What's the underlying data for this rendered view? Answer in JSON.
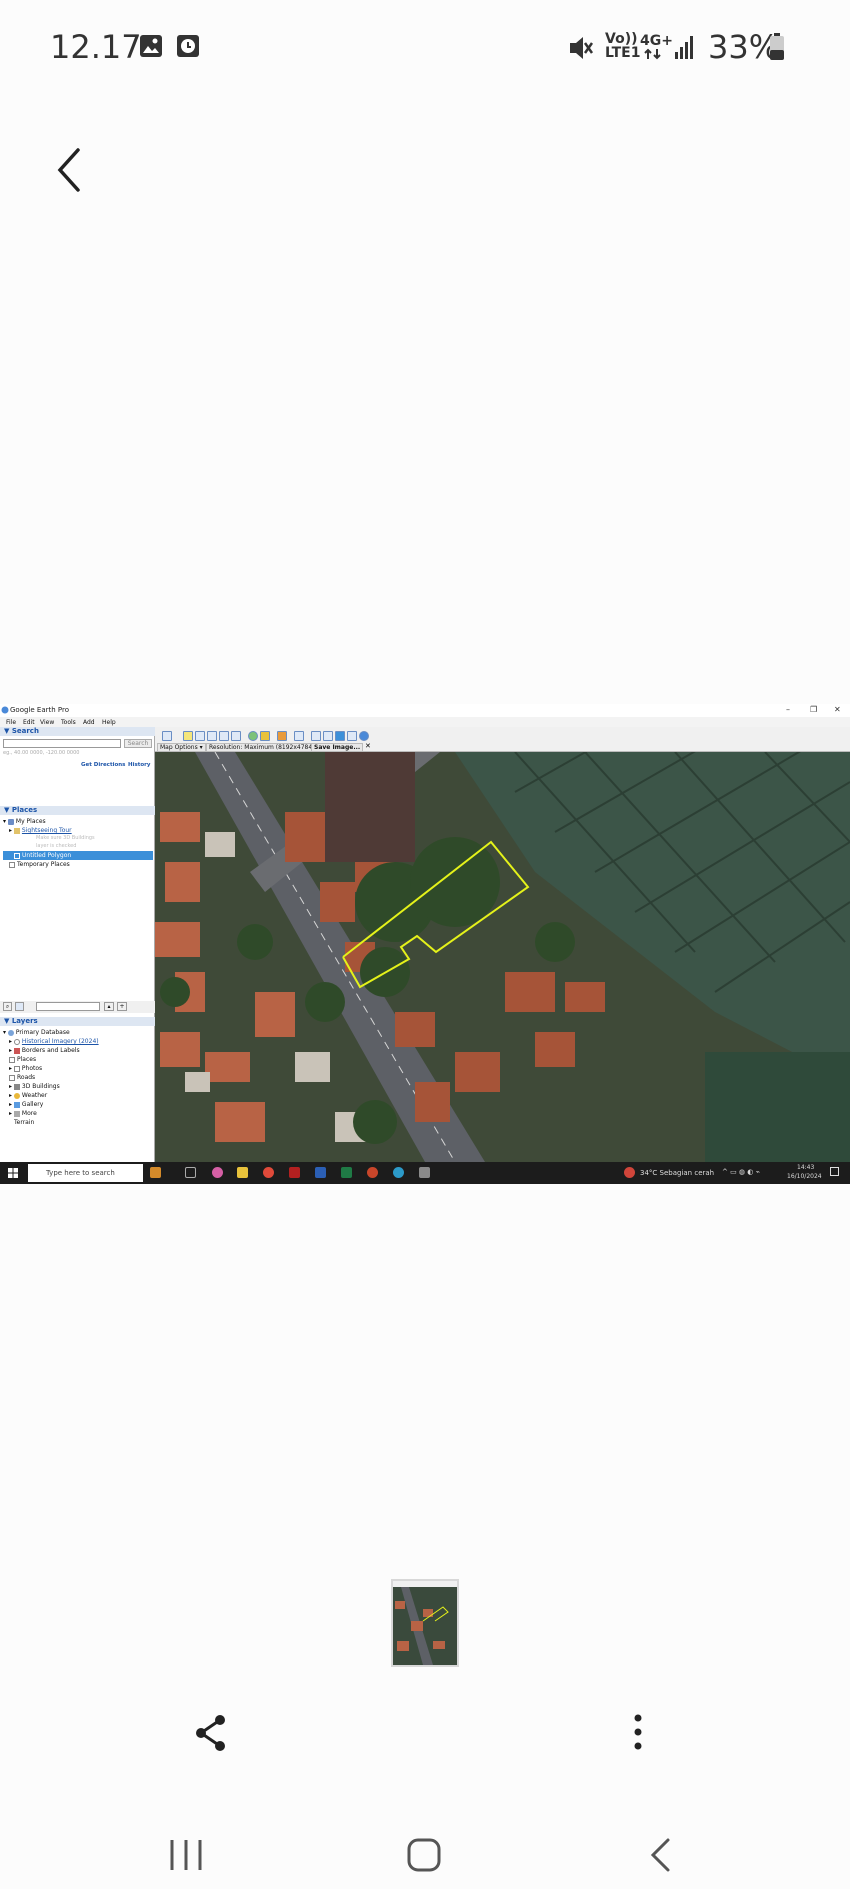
{
  "status_bar": {
    "time": "12.17",
    "network_volte": "Vo)) LTE1",
    "network_gen": "4G+",
    "battery": "33%",
    "icons": [
      "gallery-icon",
      "clock-icon",
      "mute-icon",
      "signal-icon",
      "battery-icon"
    ]
  },
  "viewer": {
    "back_icon": "back-arrow-icon",
    "share_icon": "share-icon",
    "more_icon": "more-vertical-icon"
  },
  "screenshot": {
    "window_title": "Google Earth Pro",
    "menu": [
      "File",
      "Edit",
      "View",
      "Tools",
      "Add",
      "Help"
    ],
    "search": {
      "header": "Search",
      "button": "Search",
      "hint": "eg., 40.00 0000, -120.00 0000",
      "get_directions": "Get Directions",
      "history": "History"
    },
    "places": {
      "header": "Places",
      "items": [
        "My Places",
        "Sightseeing Tour",
        "Untitled Polygon",
        "Temporary Places"
      ],
      "faded_items": [
        "Make sure 3D Buildings",
        "layer is checked"
      ]
    },
    "layers": {
      "header": "Layers",
      "items": [
        "Primary Database",
        "Historical Imagery (2024)",
        "Borders and Labels",
        "Places",
        "Photos",
        "Roads",
        "3D Buildings",
        "Weather",
        "Gallery",
        "More",
        "Terrain"
      ]
    },
    "toolbar": {
      "map_options": "Map Options",
      "resolution": "Resolution: Maximum (8192x4784)",
      "save_image": "Save Image..."
    },
    "taskbar": {
      "search_placeholder": "Type here to search",
      "weather": "34°C  Sebagian cerah",
      "clock_time": "14:43",
      "clock_date": "16/10/2024"
    }
  },
  "colors": {
    "accent": "#1c54a8",
    "selection": "#3b8fd9",
    "polygon": "#e4f21a",
    "taskbar": "#1c1c1c"
  }
}
